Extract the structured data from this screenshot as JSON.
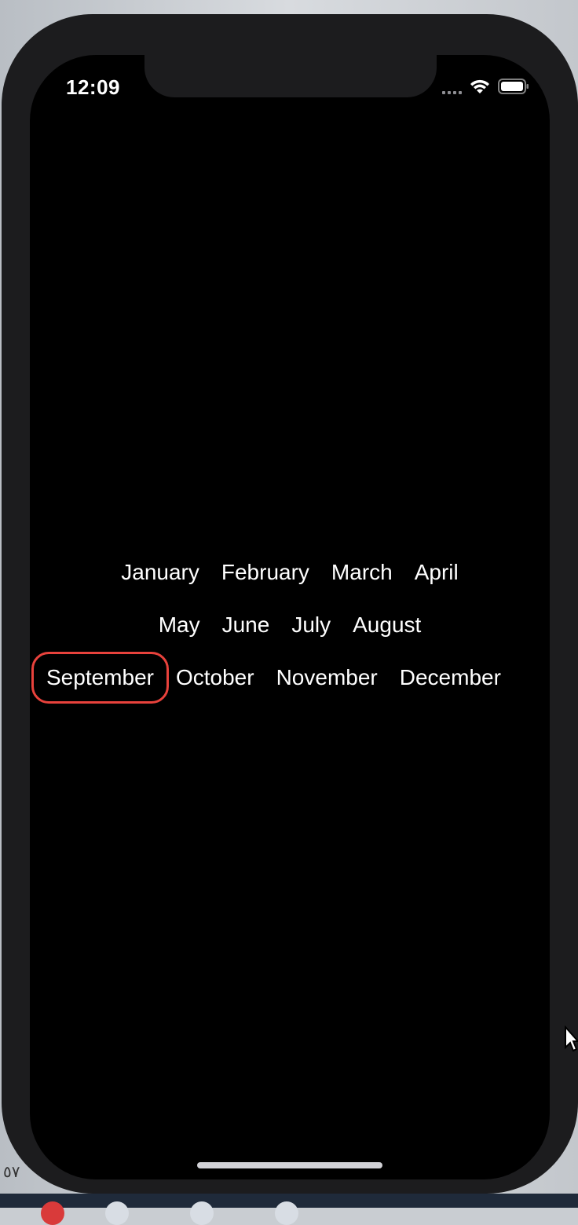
{
  "status_bar": {
    "time": "12:09",
    "icons": [
      "cellular-signal-icon",
      "wifi-icon",
      "battery-icon"
    ]
  },
  "months": {
    "rows": [
      [
        "January",
        "February",
        "March",
        "April"
      ],
      [
        "May",
        "June",
        "July",
        "August"
      ],
      [
        "September",
        "October",
        "November",
        "December"
      ]
    ],
    "selected": "September"
  },
  "colors": {
    "background": "#000000",
    "text": "#ffffff",
    "focus_ring": "#e8423c",
    "frame": "#1c1c1e"
  },
  "desktop": {
    "corner_text": "٥٧"
  }
}
